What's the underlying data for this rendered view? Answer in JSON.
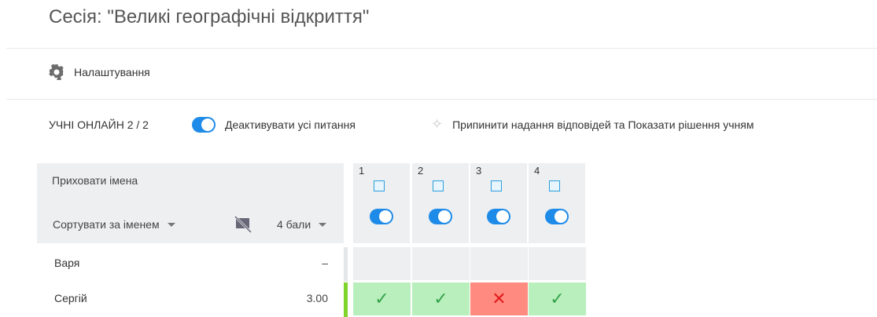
{
  "session": {
    "title": "Сесія: \"Великі географічні відкриття\""
  },
  "toolbar": {
    "settings": "Налаштування"
  },
  "controls": {
    "online": "УЧНІ ОНЛАЙН 2 / 2",
    "deactivate": "Деактивувати усі питання",
    "stop": "Припинити надання відповідей та Показати рішення учням"
  },
  "table": {
    "hide_names": "Приховати імена",
    "sort": "Сортувати за іменем",
    "points": "4 бали",
    "questions": [
      {
        "num": "1",
        "icon": "text-question-icon",
        "active": true
      },
      {
        "num": "2",
        "icon": "list-question-icon",
        "active": true
      },
      {
        "num": "3",
        "icon": "diagram-question-icon",
        "active": true
      },
      {
        "num": "4",
        "icon": "grid-question-icon",
        "active": true
      }
    ],
    "students": [
      {
        "name": "Варя",
        "score": "–",
        "answers": [
          "empty",
          "empty",
          "empty",
          "empty"
        ]
      },
      {
        "name": "Сергій",
        "score": "3.00",
        "answers": [
          "correct",
          "correct",
          "wrong",
          "correct"
        ]
      }
    ]
  },
  "colors": {
    "accent": "#1f8be8",
    "correct": "#b9efbd",
    "wrong": "#ff8b80",
    "progress": "#7fd42b"
  }
}
